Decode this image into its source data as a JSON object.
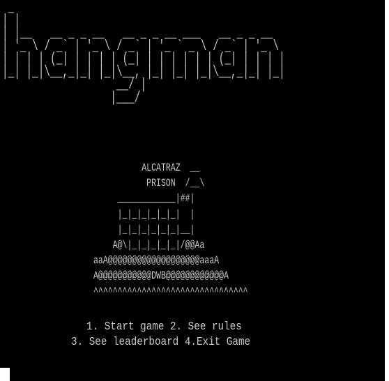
{
  "logo_art": " _\n| |\n| |__   __ _ _ __   __ _ _ __ ___   __ _ _ __\n| '_ \\ / _` | '_ \\ / _` | '_ ` _ \\ / _` | '_ \\\n| | | | (_| | | | | (_| | | | | | | (_| | | | |\n|_| |_|\\__,_|_| |_|\\__, |_| |_| |_|\\__,_|_| |_|\n                   __/ |\n                  |___/",
  "prison_art": "          ALCATRAZ  __\n           PRISON  /__\\\n     ____________|##|\n     |_|_|_|_|_|_|  |\n     |_|_|_|_|_|_|__|\n    A@\\|_|_|_|_|_|/@@Aa\naaA@@@@@@@@@@@@@@@@@@@aaaA\nA@@@@@@@@@@@DWB@@@@@@@@@@@@A\n^^^^^^^^^^^^^^^^^^^^^^^^^^^^^^^^",
  "menu": {
    "line_1": "1. Start game 2. See rules",
    "line_2": "3. See leaderboard 4.Exit Game"
  },
  "colors": {
    "background": "#000000",
    "text": "#c8c8c8"
  }
}
